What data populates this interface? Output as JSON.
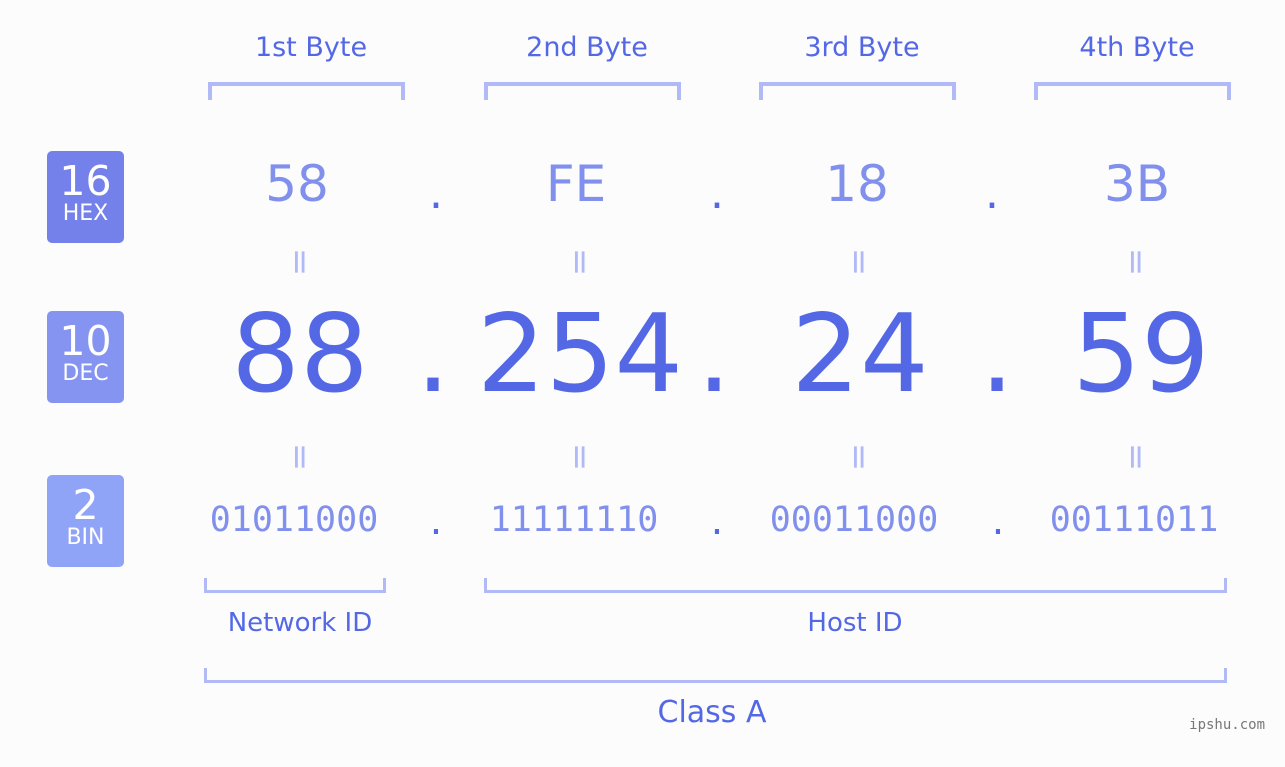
{
  "byte_headers": [
    "1st Byte",
    "2nd Byte",
    "3rd Byte",
    "4th Byte"
  ],
  "badges": {
    "hex": {
      "base": "16",
      "label": "HEX",
      "color": "#7481ea"
    },
    "dec": {
      "base": "10",
      "label": "DEC",
      "color": "#8594f0"
    },
    "bin": {
      "base": "2",
      "label": "BIN",
      "color": "#8fa3f7"
    }
  },
  "hex": [
    "58",
    "FE",
    "18",
    "3B"
  ],
  "dec": [
    "88",
    "254",
    "24",
    "59"
  ],
  "bin": [
    "01011000",
    "11111110",
    "00011000",
    "00111011"
  ],
  "separator": ".",
  "equals": "=",
  "segments": {
    "network": "Network ID",
    "host": "Host ID",
    "class": "Class A"
  },
  "watermark": "ipshu.com"
}
